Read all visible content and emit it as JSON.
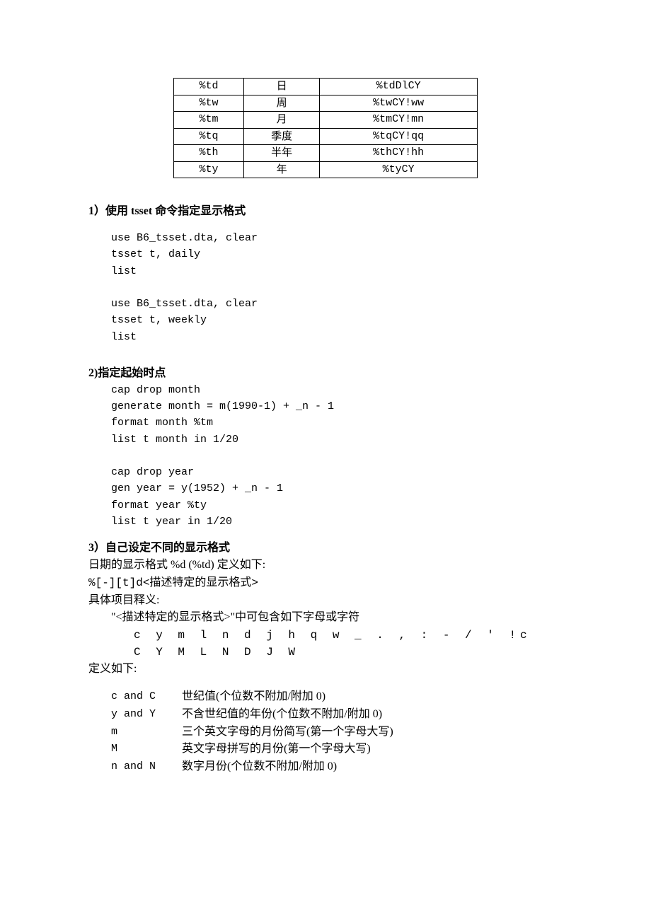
{
  "table": {
    "rows": [
      {
        "c1": "%td",
        "c2": "日",
        "c3": "%tdDlCY"
      },
      {
        "c1": "%tw",
        "c2": "周",
        "c3": "%twCY!ww"
      },
      {
        "c1": "%tm",
        "c2": "月",
        "c3": "%tmCY!mn"
      },
      {
        "c1": "%tq",
        "c2": "季度",
        "c3": "%tqCY!qq"
      },
      {
        "c1": "%th",
        "c2": "半年",
        "c3": "%thCY!hh"
      },
      {
        "c1": "%ty",
        "c2": "年",
        "c3": "%tyCY"
      }
    ]
  },
  "h1": "1）使用 tsset 命令指定显示格式",
  "code1": "use B6_tsset.dta, clear\ntsset t, daily\nlist\n\nuse B6_tsset.dta, clear\ntsset t, weekly\nlist",
  "h2": "2)指定起始时点",
  "code2": "cap drop month\ngenerate month = m(1990-1) + _n - 1\nformat month %tm\nlist t month in 1/20\n\ncap drop year\ngen year = y(1952) + _n - 1\nformat year %ty\nlist t year in 1/20",
  "h3": "3）自己设定不同的显示格式",
  "line3a": "日期的显示格式 %d (%td) 定义如下:",
  "line3b": "%[-][t]d<描述特定的显示格式>",
  "line3c": "具体项目释义:",
  "line3d": "\"<描述特定的显示格式>\"中可包含如下字母或字符",
  "chars1": "c y m l n d j h q w _ . , : - / ' !c",
  "chars2": "C Y M L N D J     W",
  "line3e": "定义如下:",
  "defs": [
    {
      "k": "c and C",
      "v": "世纪值(个位数不附加/附加 0)"
    },
    {
      "k": "y and Y",
      "v": "不含世纪值的年份(个位数不附加/附加 0)"
    },
    {
      "k": "m",
      "v": "三个英文字母的月份简写(第一个字母大写)"
    },
    {
      "k": "M",
      "v": "英文字母拼写的月份(第一个字母大写)"
    },
    {
      "k": "n and N",
      "v": "数字月份(个位数不附加/附加 0)"
    }
  ]
}
